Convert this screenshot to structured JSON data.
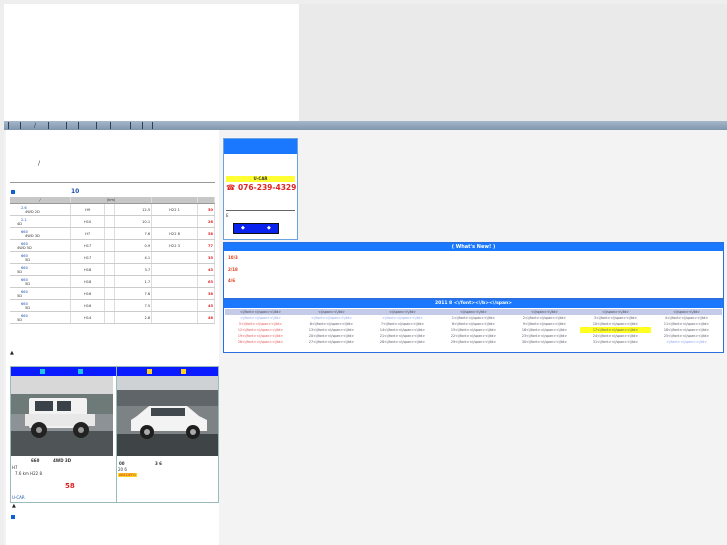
{
  "nav": {
    "separators": [
      "|",
      "/",
      "|",
      "|",
      "|",
      "|",
      "|",
      "|",
      "|"
    ],
    "slash": "/"
  },
  "intro": {
    "slash": "/"
  },
  "stock": {
    "count": "10",
    "unit_header": "(km)",
    "header_slash": "/"
  },
  "cars": [
    {
      "name": "2.6",
      "sub": "4WD 2D",
      "year": "H9",
      "km": "12.5",
      "inspect": "H22 1",
      "price": "50"
    },
    {
      "name": "2.1",
      "sub": "4D",
      "year": "H10",
      "km": "10.1",
      "inspect": "",
      "price": "28"
    },
    {
      "name": "660",
      "sub": "4WD 3D",
      "year": "H7",
      "km": "7.6",
      "inspect": "H22 8",
      "price": "58"
    },
    {
      "name": "660",
      "sub": "4WD 5D",
      "year": "H17",
      "km": "0.9",
      "inspect": "H22 3",
      "price": "77"
    },
    {
      "name": "660",
      "sub": "5D",
      "year": "H17",
      "km": "4.1",
      "inspect": "",
      "price": "35"
    },
    {
      "name": "660",
      "sub": "5D",
      "year": "H18",
      "km": "3.7",
      "inspect": "",
      "price": "43"
    },
    {
      "name": "660",
      "sub": "5D",
      "year": "H18",
      "km": "1.7",
      "inspect": "",
      "price": "63"
    },
    {
      "name": "660",
      "sub": "5D",
      "year": "H16",
      "km": "7.8",
      "inspect": "",
      "price": "38"
    },
    {
      "name": "660",
      "sub": "5D",
      "year": "H16",
      "km": "7.5",
      "inspect": "",
      "price": "45"
    },
    {
      "name": "660",
      "sub": "5D",
      "year": "H14",
      "km": "2.8",
      "inspect": "",
      "price": "48"
    }
  ],
  "up_arrow": "▲",
  "featured": [
    {
      "title_a": "660",
      "title_b": "4WD 3D",
      "year": "H7",
      "detail": "7.6 km   H22 8",
      "price": "58",
      "link": "U-CAR",
      "stamp": ""
    },
    {
      "title_a": "00",
      "title_b": "3  6",
      "year": "20 6",
      "detail": "",
      "price": "",
      "link": "",
      "stamp": "ABCDEFG"
    }
  ],
  "contact": {
    "title": "U-CAR",
    "phone": "☎ 076-239-4329",
    "label_e": "E"
  },
  "whats_new": {
    "title": "( What's New! )",
    "items": [
      "10/3",
      "2/18",
      "4/6"
    ]
  },
  "calendar": {
    "title": "2011  8  <\\/font><\\/b><\\/span>",
    "day_names": [
      "<\\/font><\\/span><\\/td>",
      "<\\/span><\\/td>",
      "<\\/span><\\/td>",
      "<\\/span><\\/td>",
      "<\\/span><\\/td>",
      "<\\/span><\\/td>",
      "<\\/span><\\/td>"
    ],
    "weeks": [
      [
        "<\\/font><\\/span><\\/td>",
        "<\\/font><\\/span><\\/td>",
        "<\\/font><\\/span><\\/td>",
        "1<\\/font><\\/span><\\/td>",
        "2<\\/font><\\/span><\\/td>",
        "3<\\/font><\\/span><\\/td>",
        "4<\\/font><\\/span><\\/td>"
      ],
      [
        "5<\\/font><\\/span><\\/td>",
        "6<\\/font><\\/span><\\/td>",
        "7<\\/font><\\/span><\\/td>",
        "8<\\/font><\\/span><\\/td>",
        "9<\\/font><\\/span><\\/td>",
        "10<\\/font><\\/span><\\/td>",
        "11<\\/font><\\/span><\\/td>"
      ],
      [
        "12<\\/font><\\/span><\\/td>",
        "13<\\/font><\\/span><\\/td>",
        "14<\\/font><\\/span><\\/td>",
        "15<\\/font><\\/span><\\/td>",
        "16<\\/font><\\/span><\\/td>",
        "17<\\/font><\\/span><\\/td>",
        "18<\\/font><\\/span><\\/td>"
      ],
      [
        "19<\\/font><\\/span><\\/td>",
        "20<\\/font><\\/span><\\/td>",
        "21<\\/font><\\/span><\\/td>",
        "22<\\/font><\\/span><\\/td>",
        "23<\\/font><\\/span><\\/td>",
        "24<\\/font><\\/span><\\/td>",
        "25<\\/font><\\/span><\\/td>"
      ],
      [
        "26<\\/font><\\/span><\\/td>",
        "27<\\/font><\\/span><\\/td>",
        "28<\\/font><\\/span><\\/td>",
        "29<\\/font><\\/span><\\/td>",
        "30<\\/font><\\/span><\\/td>",
        "31<\\/font><\\/span><\\/td>",
        "<\\/font><\\/span><\\/td>"
      ]
    ]
  },
  "colors": {
    "accent": "#1a78ff",
    "price": "#e02424",
    "header_blue": "#0a1cff",
    "highlight": "#ffff22"
  }
}
